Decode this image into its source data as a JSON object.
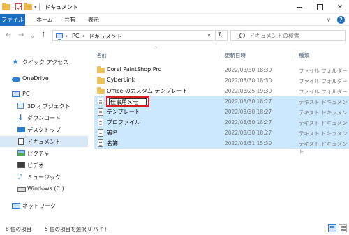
{
  "window": {
    "title": "ドキュメント"
  },
  "ribbon": {
    "tabs": [
      "ファイル",
      "ホーム",
      "共有",
      "表示"
    ]
  },
  "address": {
    "segments": [
      "PC",
      "ドキュメント"
    ],
    "search_placeholder": "ドキュメントの検索"
  },
  "nav_pane": {
    "items": [
      {
        "label": "クイック アクセス",
        "icon": "star-icon"
      },
      {
        "label": "OneDrive",
        "icon": "cloud-icon"
      },
      {
        "label": "PC",
        "icon": "pc-icon"
      },
      {
        "label": "3D オブジェクト",
        "icon": "cube-icon"
      },
      {
        "label": "ダウンロード",
        "icon": "download-arrow-icon"
      },
      {
        "label": "デスクトップ",
        "icon": "desktop-icon"
      },
      {
        "label": "ドキュメント",
        "icon": "document-icon"
      },
      {
        "label": "ピクチャ",
        "icon": "picture-icon"
      },
      {
        "label": "ビデオ",
        "icon": "video-icon"
      },
      {
        "label": "ミュージック",
        "icon": "music-note-icon"
      },
      {
        "label": "Windows (C:)",
        "icon": "drive-icon"
      },
      {
        "label": "ネットワーク",
        "icon": "network-icon"
      }
    ]
  },
  "columns": {
    "name": "名前",
    "date": "更新日時",
    "type": "種類"
  },
  "files": [
    {
      "name": "Corel PaintShop Pro",
      "date": "2022/03/30 18:30",
      "type": "ファイル フォルダー",
      "kind": "folder",
      "selected": false
    },
    {
      "name": "CyberLink",
      "date": "2022/03/30 18:30",
      "type": "ファイル フォルダー",
      "kind": "folder",
      "selected": false
    },
    {
      "name": "Office のカスタム テンプレート",
      "date": "2022/03/25 19:30",
      "type": "ファイル フォルダー",
      "kind": "folder",
      "selected": false
    },
    {
      "name": "仕事用メモ",
      "date": "2022/03/30 18:27",
      "type": "テキスト ドキュメント",
      "kind": "text",
      "selected": true,
      "renaming": true
    },
    {
      "name": "テンプレート",
      "date": "2022/03/30 18:27",
      "type": "テキスト ドキュメント",
      "kind": "text",
      "selected": true
    },
    {
      "name": "プロファイル",
      "date": "2022/03/30 18:27",
      "type": "テキスト ドキュメント",
      "kind": "text",
      "selected": true
    },
    {
      "name": "署名",
      "date": "2022/03/30 18:27",
      "type": "テキスト ドキュメント",
      "kind": "text",
      "selected": true
    },
    {
      "name": "名簿",
      "date": "2022/03/31 15:30",
      "type": "テキスト ドキュメント",
      "kind": "text",
      "selected": true
    }
  ],
  "status": {
    "count": "8 個の項目",
    "selection": "5 個の項目を選択  0 バイト"
  }
}
